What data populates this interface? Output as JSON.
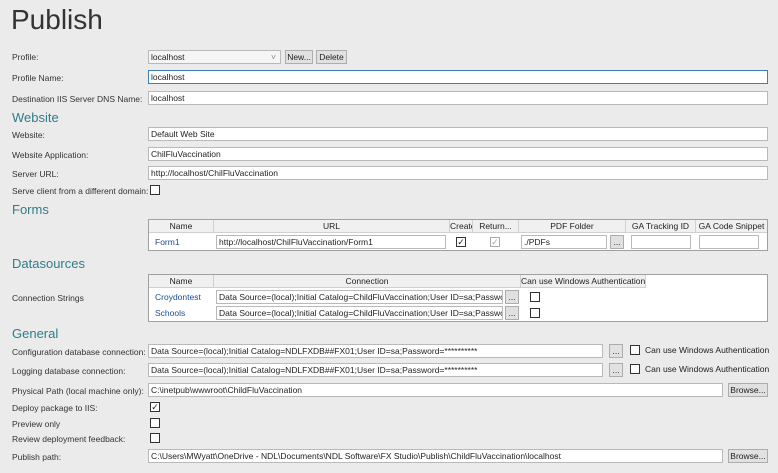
{
  "title": "Publish",
  "profile": {
    "label": "Profile:",
    "selected": "localhost",
    "new_label": "New...",
    "delete_label": "Delete"
  },
  "profile_name": {
    "label": "Profile Name:",
    "value": "localhost"
  },
  "dns_name": {
    "label": "Destination IIS Server DNS Name:",
    "value": "localhost"
  },
  "website": {
    "heading": "Website",
    "site_label": "Website:",
    "site_value": "Default Web Site",
    "app_label": "Website Application:",
    "app_value": "ChilFluVaccination",
    "url_label": "Server URL:",
    "url_value": "http://localhost/ChilFluVaccination",
    "serve_label": "Serve client from a different domain:",
    "serve_checked": false
  },
  "forms": {
    "heading": "Forms",
    "columns": [
      "Name",
      "URL",
      "Create...",
      "Return...",
      "PDF Folder",
      "GA Tracking ID",
      "GA Code Snippet"
    ],
    "rows": [
      {
        "name": "Form1",
        "url": "http://localhost/ChilFluVaccination/Form1",
        "create": true,
        "return": true,
        "pdf_folder": "./PDFs",
        "ga_tracking": "",
        "ga_snippet": "",
        "browse": "..."
      }
    ]
  },
  "datasources": {
    "heading": "Datasources",
    "label": "Connection Strings",
    "columns": [
      "Name",
      "Connection",
      "Can use Windows Authentication"
    ],
    "rows": [
      {
        "name": "Croydontest",
        "connection": "Data Source=(local);Initial Catalog=ChildFluVaccination;User ID=sa;Password=*",
        "browse": "...",
        "win_auth": false
      },
      {
        "name": "Schools",
        "connection": "Data Source=(local);Initial Catalog=ChildFluVaccination;User ID=sa;Password=*",
        "browse": "...",
        "win_auth": false
      }
    ]
  },
  "general": {
    "heading": "General",
    "config_label": "Configuration database connection:",
    "config_value": "Data Source=(local);Initial Catalog=NDLFXDB##FX01;User ID=sa;Password=**********",
    "logging_label": "Logging database connection:",
    "logging_value": "Data Source=(local);Initial Catalog=NDLFXDB##FX01;User ID=sa;Password=**********",
    "win_auth_label": "Can use Windows Authentication",
    "browse_small": "...",
    "physical_label": "Physical Path (local machine only):",
    "physical_value": "C:\\inetpub\\wwwroot\\ChildFluVaccination",
    "browse_label": "Browse...",
    "deploy_label": "Deploy package to IIS:",
    "deploy_checked": true,
    "preview_label": "Preview only",
    "preview_checked": false,
    "review_label": "Review deployment feedback:",
    "review_checked": false,
    "publish_label": "Publish path:",
    "publish_value": "C:\\Users\\MWyatt\\OneDrive - NDL\\Documents\\NDL Software\\FX Studio\\Publish\\ChildFluVaccination\\localhost"
  }
}
